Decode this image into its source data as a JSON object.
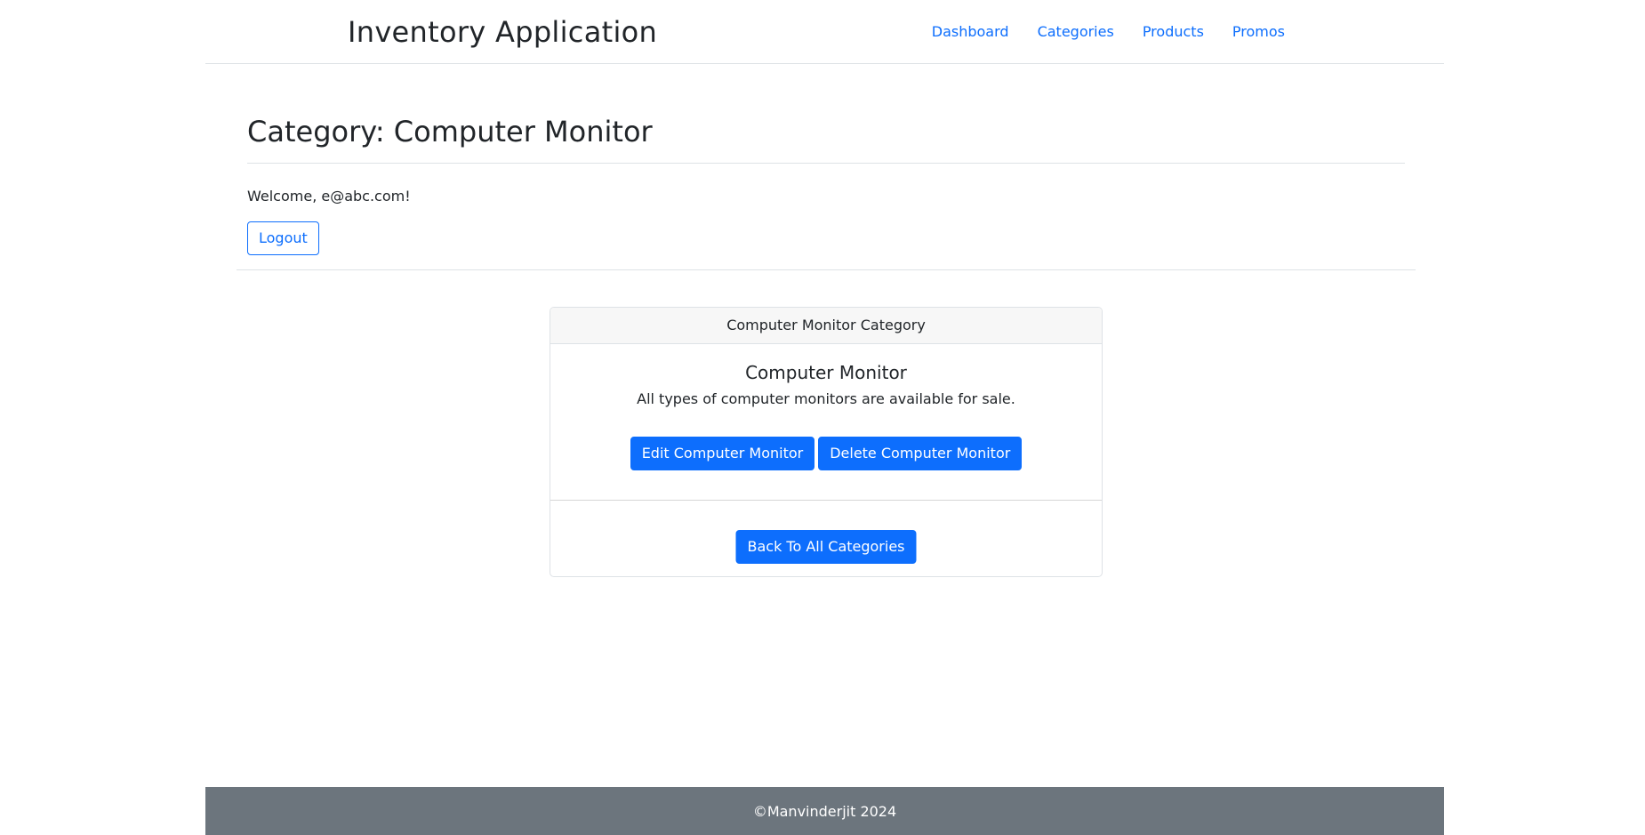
{
  "header": {
    "brand": "Inventory Application",
    "nav": [
      {
        "label": "Dashboard"
      },
      {
        "label": "Categories"
      },
      {
        "label": "Products"
      },
      {
        "label": "Promos"
      }
    ]
  },
  "page": {
    "title": "Category: Computer Monitor",
    "welcome": "Welcome, e@abc.com!",
    "logout_label": "Logout"
  },
  "card": {
    "header": "Computer Monitor Category",
    "title": "Computer Monitor",
    "description": "All types of computer monitors are available for sale.",
    "edit_label": "Edit Computer Monitor",
    "delete_label": "Delete Computer Monitor",
    "back_label": "Back To All Categories"
  },
  "footer": {
    "text": "©Manvinderjit 2024"
  },
  "colors": {
    "primary": "#0d6efd",
    "footer_bg": "#6c757d",
    "card_header_bg": "#f7f7f7"
  }
}
